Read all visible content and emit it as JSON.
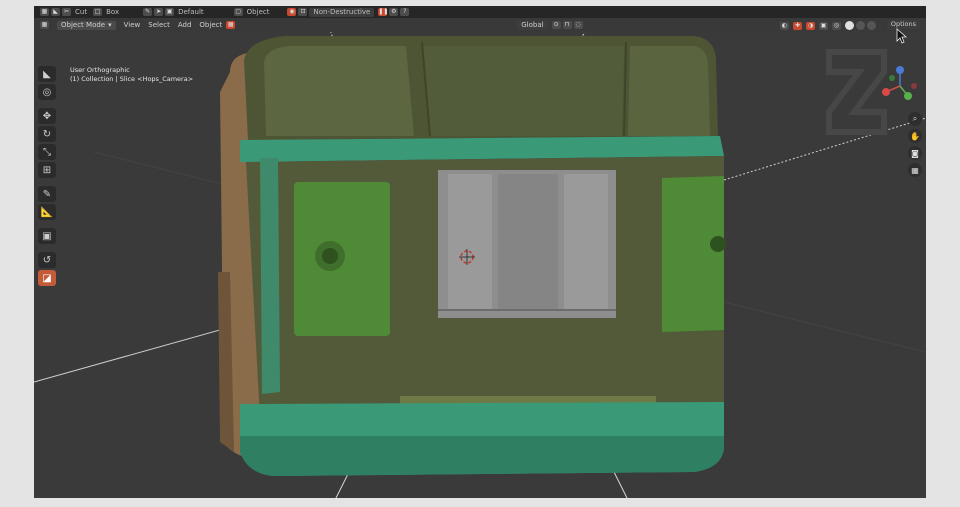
{
  "header": {
    "tool_label": "Cut",
    "shape_label": "Box",
    "default_label": "Default",
    "object_label": "Object",
    "non_destructive": "Non-Destructive",
    "options": "Options"
  },
  "menubar": {
    "mode": "Object Mode",
    "items": [
      "View",
      "Select",
      "Add",
      "Object"
    ],
    "transform_orientation": "Global"
  },
  "viewport": {
    "view_name": "User Orthographic",
    "collection_info": "(1) Collection | Slice <Hops_Camera>"
  },
  "gizmo": {
    "x": "X",
    "y": "Y",
    "z": "Z"
  },
  "colors": {
    "accent": "#c35a38",
    "teal": "#3a9a78",
    "olive": "#535a3a",
    "green_panel": "#4f8a36"
  },
  "icons": [
    "select-box-icon",
    "cursor-icon",
    "move-icon",
    "rotate-icon",
    "scale-icon",
    "transform-icon",
    "annotate-icon",
    "measure-icon",
    "add-cube-icon",
    "spin-icon",
    "hops-icon",
    "zoom-icon",
    "hand-icon",
    "camera-icon",
    "grid-icon"
  ]
}
